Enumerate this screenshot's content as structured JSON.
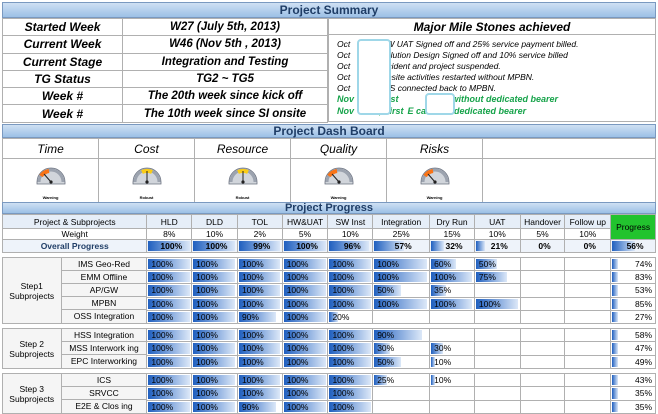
{
  "summary": {
    "title": "Project Summary",
    "rows": [
      {
        "label": "Started Week",
        "value": "W27 (July 5th, 2013)"
      },
      {
        "label": "Current Week",
        "value": "W46 (Nov 5th , 2013)"
      },
      {
        "label": "Current Stage",
        "value": "Integration and Testing"
      },
      {
        "label": "TG Status",
        "value": "TG2 ~ TG5"
      },
      {
        "label": "Week #",
        "value": "The 20th week  since kick off"
      },
      {
        "label": "Week #",
        "value": "The 10th week  since SI onsite"
      }
    ],
    "milestones_title": "Major Mile Stones achieved",
    "milestones": [
      {
        "prefix": "Oct",
        "text": "HW UAT Signed off and 25% service payment billed."
      },
      {
        "prefix": "Oct",
        "text": "Solution Design Signed off and 10% service  billed"
      },
      {
        "prefix": "Oct",
        "text": "Incident and project suspended."
      },
      {
        "prefix": "Oct",
        "text": "Onsite activities restarted without MPBN."
      },
      {
        "prefix": "Oct",
        "text": "IMS connected back to MPBN."
      }
    ],
    "milestones_green": [
      {
        "prefix": "Nov",
        "mid": ", First",
        "text": "Call without dedicated bearer"
      },
      {
        "prefix": "Nov",
        "mid": "3, First",
        "text": "E call with dedicated bearer"
      }
    ]
  },
  "dashboard": {
    "title": "Project Dash Board",
    "headers": [
      "Time",
      "Cost",
      "Resource",
      "Quality",
      "Risks"
    ],
    "gauges": [
      {
        "state": "Warning",
        "color": "#f97316"
      },
      {
        "state": "Robust",
        "color": "#facc15"
      },
      {
        "state": "Robust",
        "color": "#facc15"
      },
      {
        "state": "Warning",
        "color": "#f97316"
      },
      {
        "state": "Warning",
        "color": "#f97316"
      }
    ]
  },
  "progress": {
    "title": "Project Progress",
    "columns": [
      "Project & Subprojects",
      "HLD",
      "DLD",
      "TOL",
      "HW&UAT",
      "SW Inst",
      "Integration",
      "Dry Run",
      "UAT",
      "Handover",
      "Follow up",
      "Progress"
    ],
    "weight_label": "Weight",
    "weights": [
      "8%",
      "10%",
      "2%",
      "5%",
      "10%",
      "25%",
      "15%",
      "10%",
      "5%",
      "10%"
    ],
    "overall_label": "Overall Progress",
    "overall": [
      "100%",
      "100%",
      "99%",
      "100%",
      "96%",
      "57%",
      "32%",
      "21%",
      "0%",
      "0%",
      "56%"
    ],
    "groups": [
      {
        "step": "Step1 Subprojects",
        "rows": [
          {
            "name": "IMS Geo-Red",
            "values": [
              "100%",
              "100%",
              "100%",
              "100%",
              "100%",
              "100%",
              "60%",
              "50%",
              "",
              ""
            ],
            "progress": "74%"
          },
          {
            "name": "EMM Offline",
            "values": [
              "100%",
              "100%",
              "100%",
              "100%",
              "100%",
              "100%",
              "100%",
              "75%",
              "",
              ""
            ],
            "progress": "83%"
          },
          {
            "name": "AP/GW",
            "values": [
              "100%",
              "100%",
              "100%",
              "100%",
              "100%",
              "50%",
              "35%",
              "",
              "",
              ""
            ],
            "progress": "53%"
          },
          {
            "name": "MPBN",
            "values": [
              "100%",
              "100%",
              "100%",
              "100%",
              "100%",
              "100%",
              "100%",
              "100%",
              "",
              ""
            ],
            "progress": "85%"
          },
          {
            "name": "OSS Integration",
            "values": [
              "100%",
              "100%",
              "90%",
              "100%",
              "20%",
              "",
              "",
              "",
              "",
              ""
            ],
            "progress": "27%"
          }
        ]
      },
      {
        "step": "Step 2 Subprojects",
        "rows": [
          {
            "name": "HSS Integration",
            "values": [
              "100%",
              "100%",
              "100%",
              "100%",
              "100%",
              "90%",
              "",
              "",
              "",
              ""
            ],
            "progress": "58%"
          },
          {
            "name": "MSS Interwork ing",
            "values": [
              "100%",
              "100%",
              "100%",
              "100%",
              "100%",
              "30%",
              "30%",
              "",
              "",
              ""
            ],
            "progress": "47%"
          },
          {
            "name": "EPC Interworking",
            "values": [
              "100%",
              "100%",
              "100%",
              "100%",
              "100%",
              "50%",
              "10%",
              "",
              "",
              ""
            ],
            "progress": "49%"
          }
        ]
      },
      {
        "step": "Step 3 Subprojects",
        "rows": [
          {
            "name": "ICS",
            "values": [
              "100%",
              "100%",
              "100%",
              "100%",
              "100%",
              "25%",
              "10%",
              "",
              "",
              ""
            ],
            "progress": "43%"
          },
          {
            "name": "SRVCC",
            "values": [
              "100%",
              "100%",
              "100%",
              "100%",
              "100%",
              "",
              "",
              "",
              "",
              ""
            ],
            "progress": "35%"
          },
          {
            "name": "E2E & Clos ing",
            "values": [
              "100%",
              "100%",
              "90%",
              "100%",
              "100%",
              "",
              "",
              "",
              "",
              ""
            ],
            "progress": "35%"
          }
        ]
      }
    ]
  }
}
